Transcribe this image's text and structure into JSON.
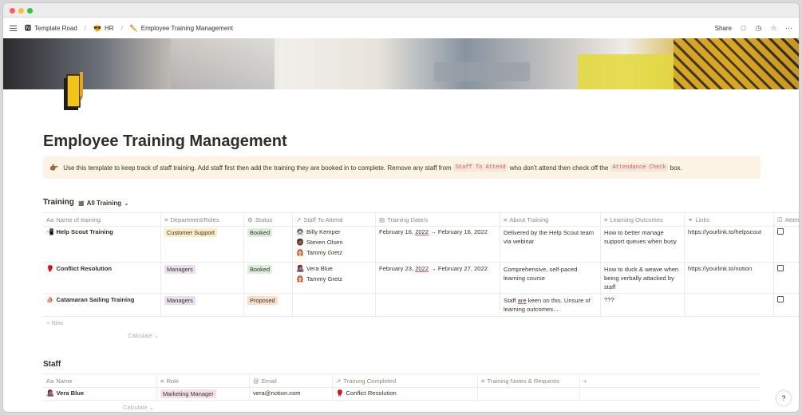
{
  "breadcrumb": [
    {
      "icon": "🅽",
      "label": "Template Road"
    },
    {
      "icon": "😎",
      "label": "HR"
    },
    {
      "icon": "✏️",
      "label": "Employee Training Management"
    }
  ],
  "toolbar": {
    "share_label": "Share",
    "comment_icon": "comment-icon",
    "clock_icon": "clock-icon",
    "star_icon": "star-icon",
    "more_icon": "more-icon"
  },
  "page": {
    "title": "Employee Training Management",
    "callout": {
      "emoji": "👉🏾",
      "text_1": "Use this template to keep track of staff training. Add staff first then add the training they are booked in to complete. Remove any staff from",
      "code_1": "Staff To Attend",
      "text_2": "who don't attend then check off the",
      "code_2": "Attendance Check",
      "text_3": "box."
    }
  },
  "training": {
    "title": "Training",
    "view_label": "All Training",
    "columns": [
      "Name of training",
      "Department/Roles",
      "Status",
      "Staff To Attend",
      "Training Date/s",
      "About Training",
      "Learning Outcomes",
      "Links",
      "Atten"
    ],
    "rows": [
      {
        "icon": "📲",
        "name": "Help Scout Training",
        "department": "Customer Support",
        "department_color": "yellow",
        "status": "Booked",
        "status_color": "green",
        "staff": [
          {
            "avatar": "🧑🏻‍🚀",
            "name": "Billy Kemper"
          },
          {
            "avatar": "🧔🏾",
            "name": "Steven Olsen"
          },
          {
            "avatar": "👩🏻‍🚒",
            "name": "Tammy Gretz"
          }
        ],
        "date_start": "February 16,",
        "date_year_1": "2022",
        "date_end": "→ February 16, 2022",
        "about": "Delivered by the Help Scout team via webinar",
        "outcomes": "How to better manage support queues when busy",
        "link": "https://yourlink.to/helpscout"
      },
      {
        "icon": "🥊",
        "name": "Conflict Resolution",
        "department": "Managers",
        "department_color": "purple",
        "status": "Booked",
        "status_color": "green",
        "staff": [
          {
            "avatar": "👩🏽‍🎤",
            "name": "Vera Blue"
          },
          {
            "avatar": "👩🏻‍🚒",
            "name": "Tammy Gretz"
          }
        ],
        "date_start": "February 23,",
        "date_year_1": "2022",
        "date_end": "→ February 27, 2022",
        "about": "Comprehensive, self-paced learning course",
        "outcomes": "How to duck & weave when being verbally attacked by staff",
        "link": "https://yourlink.to/notion"
      },
      {
        "icon": "⛵",
        "name": "Catamaran Sailing Training",
        "department": "Managers",
        "department_color": "purple",
        "status": "Proposed",
        "status_color": "orange",
        "staff": [],
        "about_pre": "Staff",
        "about_und": "are",
        "about_post": "keen on this. Unsure of learning outcomes...",
        "outcomes": "???",
        "link": ""
      }
    ],
    "new_label": "New",
    "calculate_label": "Calculate"
  },
  "staff": {
    "title": "Staff",
    "columns": [
      "Name",
      "Role",
      "Email",
      "Training Completed",
      "Training Notes & Requests"
    ],
    "add_label": "+",
    "rows": [
      {
        "avatar": "👩🏽‍🎤",
        "name": "Vera Blue",
        "role": "Marketing Manager",
        "email": "vera@notion.com",
        "training_icon": "🥊",
        "training": "Conflict Resolution",
        "notes": ""
      }
    ],
    "calculate_label": "Calculate"
  },
  "help_label": "?"
}
